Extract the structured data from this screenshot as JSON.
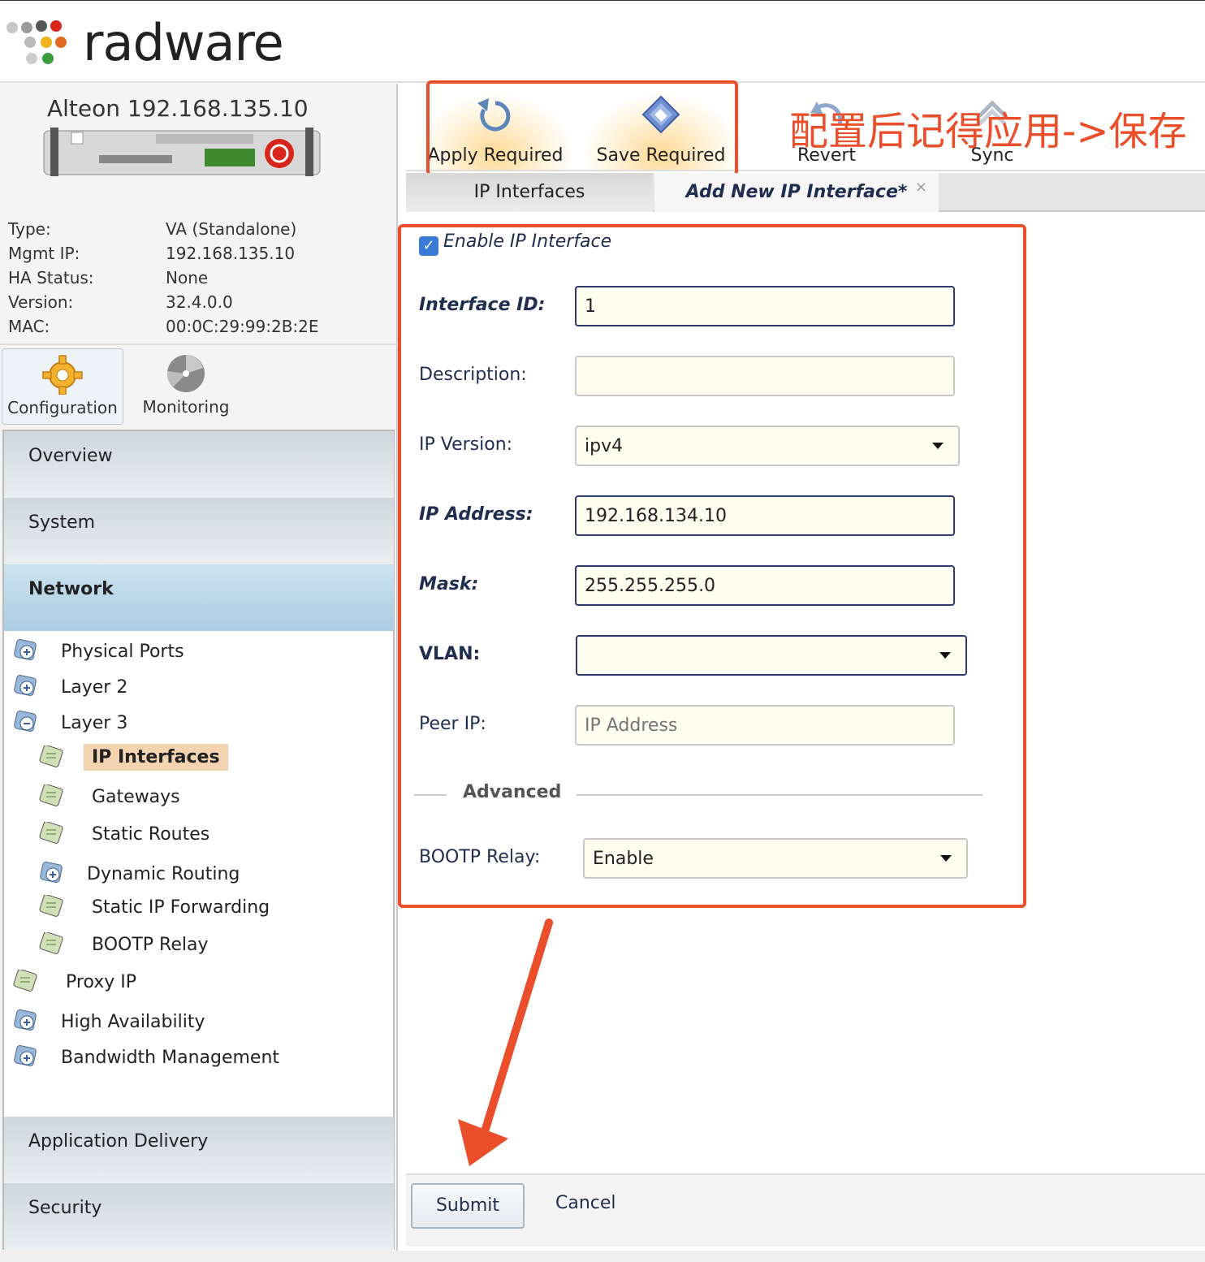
{
  "brand": {
    "logo_text": "radware"
  },
  "device": {
    "title": "Alteon 192.168.135.10",
    "info": [
      {
        "key": "Type:",
        "value": "VA (Standalone)"
      },
      {
        "key": "Mgmt IP:",
        "value": "192.168.135.10"
      },
      {
        "key": "HA Status:",
        "value": "None"
      },
      {
        "key": "Version:",
        "value": "32.4.0.0"
      },
      {
        "key": "MAC:",
        "value": "00:0C:29:99:2B:2E"
      }
    ]
  },
  "mode_tabs": {
    "configuration": "Configuration",
    "monitoring": "Monitoring"
  },
  "nav": {
    "groups": {
      "overview": "Overview",
      "system": "System",
      "network": "Network",
      "application_delivery": "Application Delivery",
      "security": "Security"
    },
    "tree": {
      "physical_ports": "Physical Ports",
      "layer2": "Layer 2",
      "layer3": "Layer 3",
      "ip_interfaces": "IP Interfaces",
      "gateways": "Gateways",
      "static_routes": "Static Routes",
      "dynamic_routing": "Dynamic Routing",
      "static_ip_forwarding": "Static IP Forwarding",
      "bootp_relay": "BOOTP Relay",
      "proxy_ip": "Proxy IP",
      "high_availability": "High Availability",
      "bandwidth_management": "Bandwidth Management"
    }
  },
  "toolbar": {
    "apply": "Apply Required",
    "save": "Save Required",
    "revert": "Revert",
    "sync": "Sync"
  },
  "annotation": "配置后记得应用->保存",
  "tabs": {
    "ip_interfaces": "IP Interfaces",
    "add_new": "Add New IP Interface*",
    "close": "×"
  },
  "form": {
    "enable_label": "Enable IP Interface",
    "enable_checked": true,
    "interface_id_label": "Interface ID:",
    "interface_id_value": "1",
    "description_label": "Description:",
    "description_value": "",
    "ip_version_label": "IP Version:",
    "ip_version_value": "ipv4",
    "ip_address_label": "IP Address:",
    "ip_address_value": "192.168.134.10",
    "mask_label": "Mask:",
    "mask_value": "255.255.255.0",
    "vlan_label": "VLAN:",
    "vlan_value": "",
    "peer_ip_label": "Peer IP:",
    "peer_ip_placeholder": "IP Address",
    "advanced_title": "Advanced",
    "bootp_label": "BOOTP Relay:",
    "bootp_value": "Enable"
  },
  "footer": {
    "submit": "Submit",
    "cancel": "Cancel"
  },
  "colors": {
    "annotation_red": "#ea4e2a",
    "accent_blue": "#3a7bd5",
    "selected_bg": "#f3d3b0"
  }
}
